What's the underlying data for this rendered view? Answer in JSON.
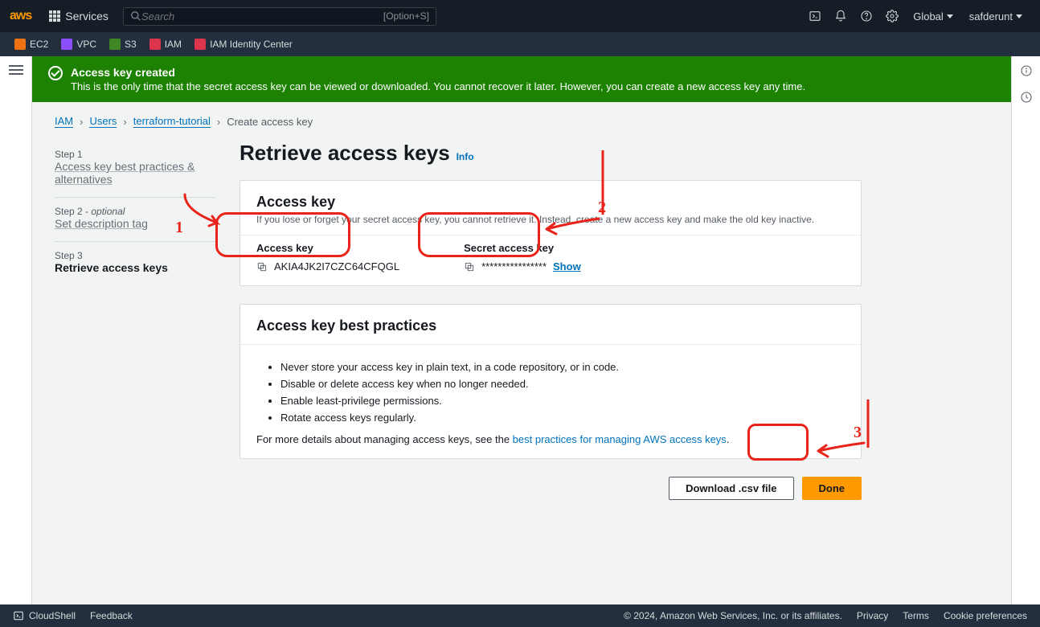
{
  "topnav": {
    "services_label": "Services",
    "search_placeholder": "Search",
    "search_kbd": "[Option+S]",
    "region": "Global",
    "account": "safderunt"
  },
  "shortcuts": [
    {
      "label": "EC2",
      "color": "#ec7211"
    },
    {
      "label": "VPC",
      "color": "#8c4fff"
    },
    {
      "label": "S3",
      "color": "#3f8624"
    },
    {
      "label": "IAM",
      "color": "#dd344c"
    },
    {
      "label": "IAM Identity Center",
      "color": "#dd344c"
    }
  ],
  "banner": {
    "title": "Access key created",
    "subtitle": "This is the only time that the secret access key can be viewed or downloaded. You cannot recover it later. However, you can create a new access key any time."
  },
  "breadcrumbs": {
    "items": [
      "IAM",
      "Users",
      "terraform-tutorial"
    ],
    "current": "Create access key"
  },
  "steps": [
    {
      "num": "Step 1",
      "optional": "",
      "label": "Access key best practices & alternatives"
    },
    {
      "num": "Step 2",
      "optional": " - optional",
      "label": "Set description tag"
    },
    {
      "num": "Step 3",
      "optional": "",
      "label": "Retrieve access keys"
    }
  ],
  "page_title": "Retrieve access keys",
  "info_label": "Info",
  "access_key_panel": {
    "title": "Access key",
    "subtitle": "If you lose or forget your secret access key, you cannot retrieve it. Instead, create a new access key and make the old key inactive.",
    "access_key_label": "Access key",
    "access_key_value": "AKIA4JK2I7CZC64CFQGL",
    "secret_label": "Secret access key",
    "secret_value": "****************",
    "show_label": "Show"
  },
  "best_practices_panel": {
    "title": "Access key best practices",
    "items": [
      "Never store your access key in plain text, in a code repository, or in code.",
      "Disable or delete access key when no longer needed.",
      "Enable least-privilege permissions.",
      "Rotate access keys regularly."
    ],
    "footer_prefix": "For more details about managing access keys, see the ",
    "footer_link": "best practices for managing AWS access keys",
    "footer_suffix": "."
  },
  "actions": {
    "download": "Download .csv file",
    "done": "Done"
  },
  "footer": {
    "cloudshell": "CloudShell",
    "feedback": "Feedback",
    "copyright": "© 2024, Amazon Web Services, Inc. or its affiliates.",
    "links": [
      "Privacy",
      "Terms",
      "Cookie preferences"
    ]
  },
  "annotations": {
    "n1": "1",
    "n2": "2",
    "n3": "3"
  }
}
